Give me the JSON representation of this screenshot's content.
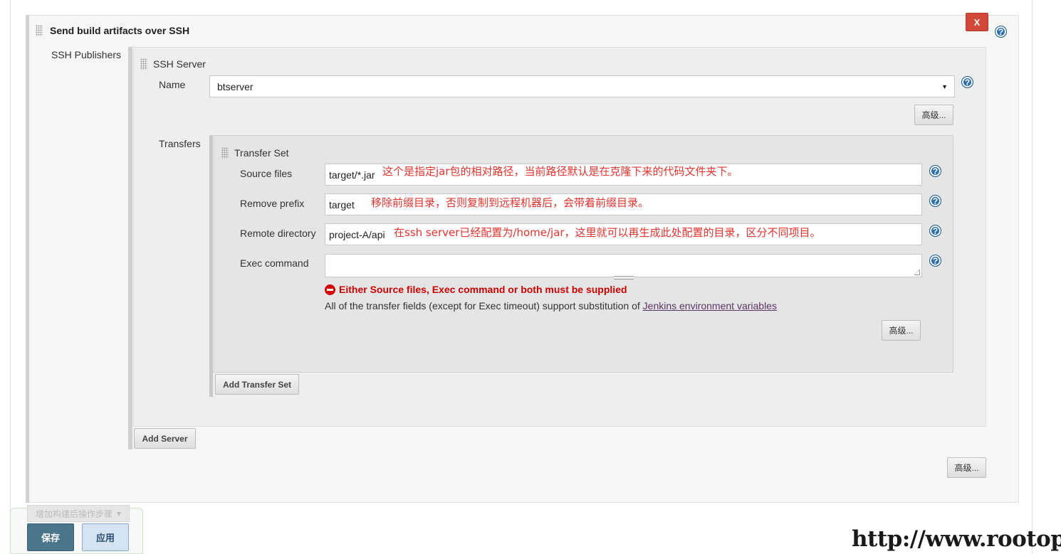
{
  "section": {
    "title": "Send build artifacts over SSH",
    "close_label": "X",
    "help": "?"
  },
  "publishers": {
    "label": "SSH Publishers",
    "server": {
      "heading": "SSH Server",
      "name_label": "Name",
      "name_value": "btserver",
      "advanced_label": "高级..."
    },
    "transfers": {
      "label": "Transfers",
      "heading": "Transfer Set",
      "source_files_label": "Source files",
      "source_files_value": "target/*.jar",
      "source_files_note": "这个是指定jar包的相对路径，当前路径默认是在克隆下来的代码文件夹下。",
      "remove_prefix_label": "Remove prefix",
      "remove_prefix_value": "target",
      "remove_prefix_note": "移除前缀目录，否则复制到远程机器后，会带着前缀目录。",
      "remote_directory_label": "Remote directory",
      "remote_directory_value": "project-A/api",
      "remote_directory_note": "在ssh server已经配置为/home/jar，这里就可以再生成此处配置的目录，区分不同项目。",
      "exec_command_label": "Exec command",
      "exec_command_value": "",
      "error_text": "Either Source files, Exec command or both must be supplied",
      "info_text": "All of the transfer fields (except for Exec timeout) support substitution of ",
      "info_link": "Jenkins environment variables",
      "advanced_label": "高级...",
      "add_transfer_label": "Add Transfer Set"
    },
    "add_server_label": "Add Server",
    "advanced_label": "高级..."
  },
  "footer": {
    "add_post_build_label": "增加构建后操作步骤",
    "save_label": "保存",
    "apply_label": "应用"
  },
  "watermark": "http://www.rootop.org",
  "colors": {
    "close_button": "#d24939",
    "help_icon": "#2c6fad",
    "error": "#cc0000",
    "annotation": "#e2332d",
    "save_button": "#4b758b",
    "apply_button": "#d5e4f3"
  }
}
